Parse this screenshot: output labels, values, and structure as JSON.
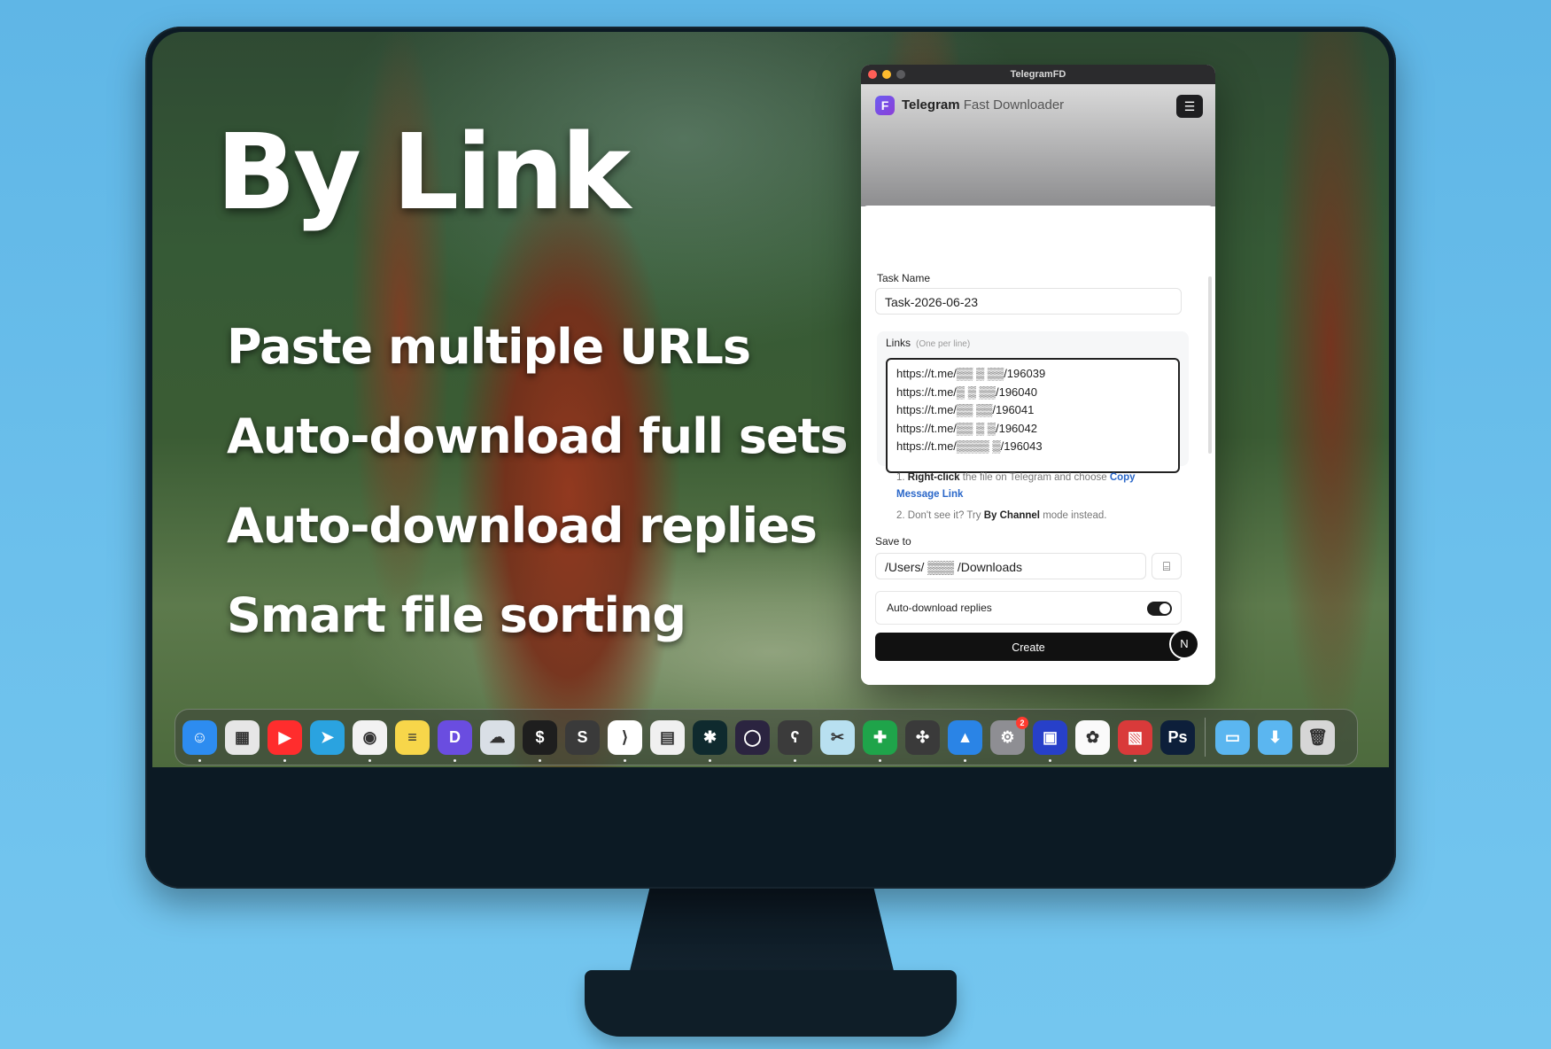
{
  "promo": {
    "title": "By Link",
    "features": [
      "Paste multiple URLs",
      "Auto-download full sets",
      "Auto-download replies",
      "Smart file sorting"
    ]
  },
  "window": {
    "title": "TelegramFD",
    "app_name_bold": "Telegram",
    "app_name_light": "Fast Downloader",
    "logo_letter": "F",
    "menu_icon": "☰"
  },
  "form": {
    "task_name_label": "Task Name",
    "task_name_value": "Task-2026-06-23",
    "links_label": "Links",
    "links_hint": "(One per line)",
    "links": [
      "https://t.me/▒▒ ▒ ▒▒/196039",
      "https://t.me/▒    ▒ ▒▒/196040",
      "https://t.me/▒▒  ▒▒/196041",
      "https://t.me/▒▒ ▒  ▒/196042",
      "https://t.me/▒▒▒▒ ▒/196043"
    ],
    "step1_prefix": "1.",
    "step1_bold": "Right-click",
    "step1_text": "the file on Telegram and choose",
    "step1_link": "Copy Message Link",
    "step2_prefix": "2. Don't see it? Try",
    "step2_bold": "By Channel",
    "step2_suffix": "mode instead.",
    "save_to_label": "Save to",
    "save_to_value": "/Users/ ▒▒▒ /Downloads",
    "auto_replies_label": "Auto-download replies",
    "auto_replies_on": true,
    "create_label": "Create",
    "n_badge": "N"
  },
  "dock": {
    "apps": [
      {
        "name": "finder-icon",
        "color": "#2d8cf0",
        "glyph": "☺"
      },
      {
        "name": "launchpad-icon",
        "color": "#e6e6e6",
        "glyph": "▦"
      },
      {
        "name": "youtube-music-icon",
        "color": "#ff2d2d",
        "glyph": "▶"
      },
      {
        "name": "telegram-icon",
        "color": "#2aa3e0",
        "glyph": "➤"
      },
      {
        "name": "chrome-icon",
        "color": "#f2f2f2",
        "glyph": "◉"
      },
      {
        "name": "notes-icon",
        "color": "#f7d64a",
        "glyph": "≡"
      },
      {
        "name": "dash-icon",
        "color": "#6a4de0",
        "glyph": "D"
      },
      {
        "name": "cloud-icon",
        "color": "#d9dfe6",
        "glyph": "☁"
      },
      {
        "name": "terminal-icon",
        "color": "#1e1e1e",
        "glyph": "$"
      },
      {
        "name": "sublime-icon",
        "color": "#3a3a3a",
        "glyph": "S"
      },
      {
        "name": "vscode-icon",
        "color": "#ffffff",
        "glyph": "⟩"
      },
      {
        "name": "claquette-icon",
        "color": "#f0f0f0",
        "glyph": "▤"
      },
      {
        "name": "perplexity-icon",
        "color": "#0f2a2e",
        "glyph": "✱"
      },
      {
        "name": "arc-icon",
        "color": "#2b2440",
        "glyph": "◯"
      },
      {
        "name": "bear-icon",
        "color": "#3b3b3b",
        "glyph": "ʕ"
      },
      {
        "name": "scissors-icon",
        "color": "#b8e0f0",
        "glyph": "✂"
      },
      {
        "name": "xcode-cleaner-icon",
        "color": "#1fa44a",
        "glyph": "✚"
      },
      {
        "name": "multiply-icon",
        "color": "#3a3a3a",
        "glyph": "✣"
      },
      {
        "name": "mountain-icon",
        "color": "#2a84e6",
        "glyph": "▲"
      },
      {
        "name": "system-settings-icon",
        "color": "#8e8e93",
        "glyph": "⚙",
        "badge": "2"
      },
      {
        "name": "frame-icon",
        "color": "#2740c9",
        "glyph": "▣"
      },
      {
        "name": "photos-icon",
        "color": "#fafafa",
        "glyph": "✿"
      },
      {
        "name": "screen-icon",
        "color": "#d93a3a",
        "glyph": "▧"
      },
      {
        "name": "photoshop-icon",
        "color": "#0d1f3a",
        "glyph": "Ps"
      }
    ],
    "folders": [
      {
        "name": "folder-icon",
        "color": "#5bb6f0",
        "glyph": "▭"
      },
      {
        "name": "downloads-folder-icon",
        "color": "#5bb6f0",
        "glyph": "⬇"
      },
      {
        "name": "trash-icon",
        "color": "#d6d6d6",
        "glyph": "🗑"
      }
    ]
  }
}
